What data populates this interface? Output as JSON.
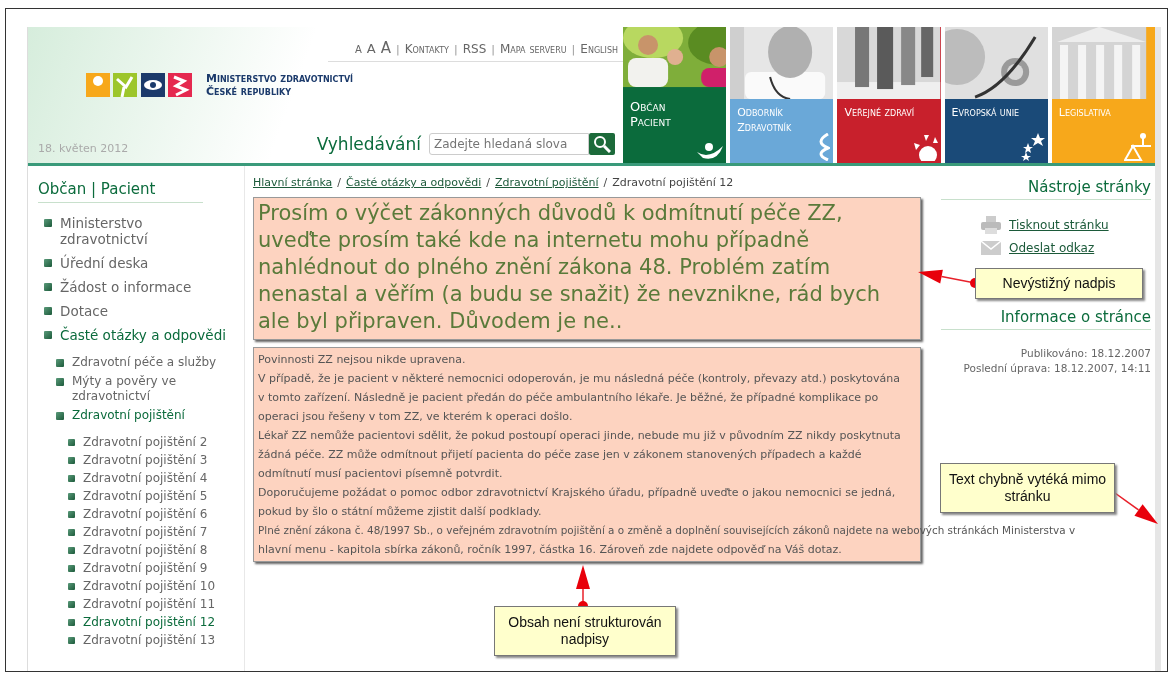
{
  "header": {
    "font_size_buttons": [
      "A",
      "A",
      "A"
    ],
    "separator": "|",
    "links": [
      "Kontakty",
      "RSS",
      "Mapa serveru",
      "English"
    ],
    "ministry": [
      "Ministerstvo zdravotnictví",
      "České republiky"
    ],
    "search_label": "Vyhledávání",
    "search": {
      "placeholder": "Zadejte hledaná slova"
    },
    "date": "18. květen 2012"
  },
  "tiles": [
    {
      "label": "Občan\nPacient",
      "color": "#0b6b3c",
      "selected": true
    },
    {
      "label": "Odborník\nZdravotník",
      "color": "#6aa8d8",
      "selected": false
    },
    {
      "label": "Veřejné zdraví",
      "color": "#c8202c",
      "selected": false
    },
    {
      "label": "Evropská unie",
      "color": "#1a4a78",
      "selected": false
    },
    {
      "label": "Legislativa",
      "color": "#f7a81b",
      "selected": false
    }
  ],
  "sidebar": {
    "title": "Občan | Pacient",
    "items": [
      {
        "label": "Ministerstvo zdravotnictví",
        "selected": false
      },
      {
        "label": "Úřední deska",
        "selected": false
      },
      {
        "label": "Žádost o informace",
        "selected": false
      },
      {
        "label": "Dotace",
        "selected": false
      },
      {
        "label": "Časté otázky a odpovědi",
        "selected": true,
        "children": [
          {
            "label": "Zdravotní péče a služby",
            "selected": false
          },
          {
            "label": "Mýty a pověry ve zdravotnictví",
            "selected": false
          },
          {
            "label": "Zdravotní pojištění",
            "selected": true,
            "children": [
              {
                "label": "Zdravotní pojištění 2",
                "selected": false
              },
              {
                "label": "Zdravotní pojištění 3",
                "selected": false
              },
              {
                "label": "Zdravotní pojištění 4",
                "selected": false
              },
              {
                "label": "Zdravotní pojištění 5",
                "selected": false
              },
              {
                "label": "Zdravotní pojištění 6",
                "selected": false
              },
              {
                "label": "Zdravotní pojištění 7",
                "selected": false
              },
              {
                "label": "Zdravotní pojištění 8",
                "selected": false
              },
              {
                "label": "Zdravotní pojištění 9",
                "selected": false
              },
              {
                "label": "Zdravotní pojištění 10",
                "selected": false
              },
              {
                "label": "Zdravotní pojištění 11",
                "selected": false
              },
              {
                "label": "Zdravotní pojištění 12",
                "selected": true
              },
              {
                "label": "Zdravotní pojištění 13",
                "selected": false
              }
            ]
          }
        ]
      }
    ]
  },
  "breadcrumb": {
    "separator": "/",
    "links": [
      "Hlavní stránka",
      "Časté otázky a odpovědi",
      "Zdravotní pojištění"
    ],
    "current": "Zdravotní pojištění 12"
  },
  "article": {
    "heading": "Prosím o výčet zákonných důvodů k odmítnutí péče ZZ, uveďte prosím také kde na internetu mohu případně nahlédnout do plného znění zákona 48. Problém zatím nenastal a věřím (a budu se snažit) že nevznikne, rád bych ale byl připraven. Důvodem je ne..",
    "paragraphs": [
      "Povinnosti ZZ nejsou nikde upravena.",
      "V případě, že je pacient v některé nemocnici odoperován, je mu následná péče (kontroly, převazy atd.) poskytována v tomto zařízení. Následně je pacient předán do péče ambulantního lékaře. Je běžné, že případné komplikace po operaci jsou řešeny v tom ZZ, ve kterém k operaci došlo.",
      " Lékař ZZ nemůže pacientovi sdělit, že pokud postoupí operaci jinde, nebude mu již v původním ZZ nikdy poskytnuta žádná péče. ZZ může odmítnout přijetí pacienta do péče zase jen v zákonem stanovených případech a každé odmítnutí musí pacientovi písemně potvrdit.",
      "Doporučujeme požádat o pomoc odbor zdravotnictví Krajského úřadu, případně uveďte o jakou nemocnici se jedná, pokud by šlo o státní můžeme zjistit další podklady."
    ],
    "overflow_line": "Plné znění zákona č. 48/1997 Sb., o veřejném zdravotním pojištění a o změně a doplnění souvisejících zákonů najdete na webových stránkách Ministerstva v",
    "last_line": "hlavní menu -  kapitola sbírka zákonů, ročník 1997, částka 16. Zároveň zde najdete odpověď na Váš dotaz."
  },
  "tools": {
    "title": "Nástroje stránky",
    "links": [
      "Tisknout stránku",
      "Odeslat odkaz"
    ]
  },
  "info": {
    "title": "Informace o stránce",
    "published": "Publikováno: 18.12.2007",
    "modified": "Poslední úprava: 18.12.2007, 14:11"
  },
  "annotations": [
    "Nevýstižný nadpis",
    "Text chybně vytéká mimo stránku",
    "Obsah není strukturován nadpisy"
  ]
}
